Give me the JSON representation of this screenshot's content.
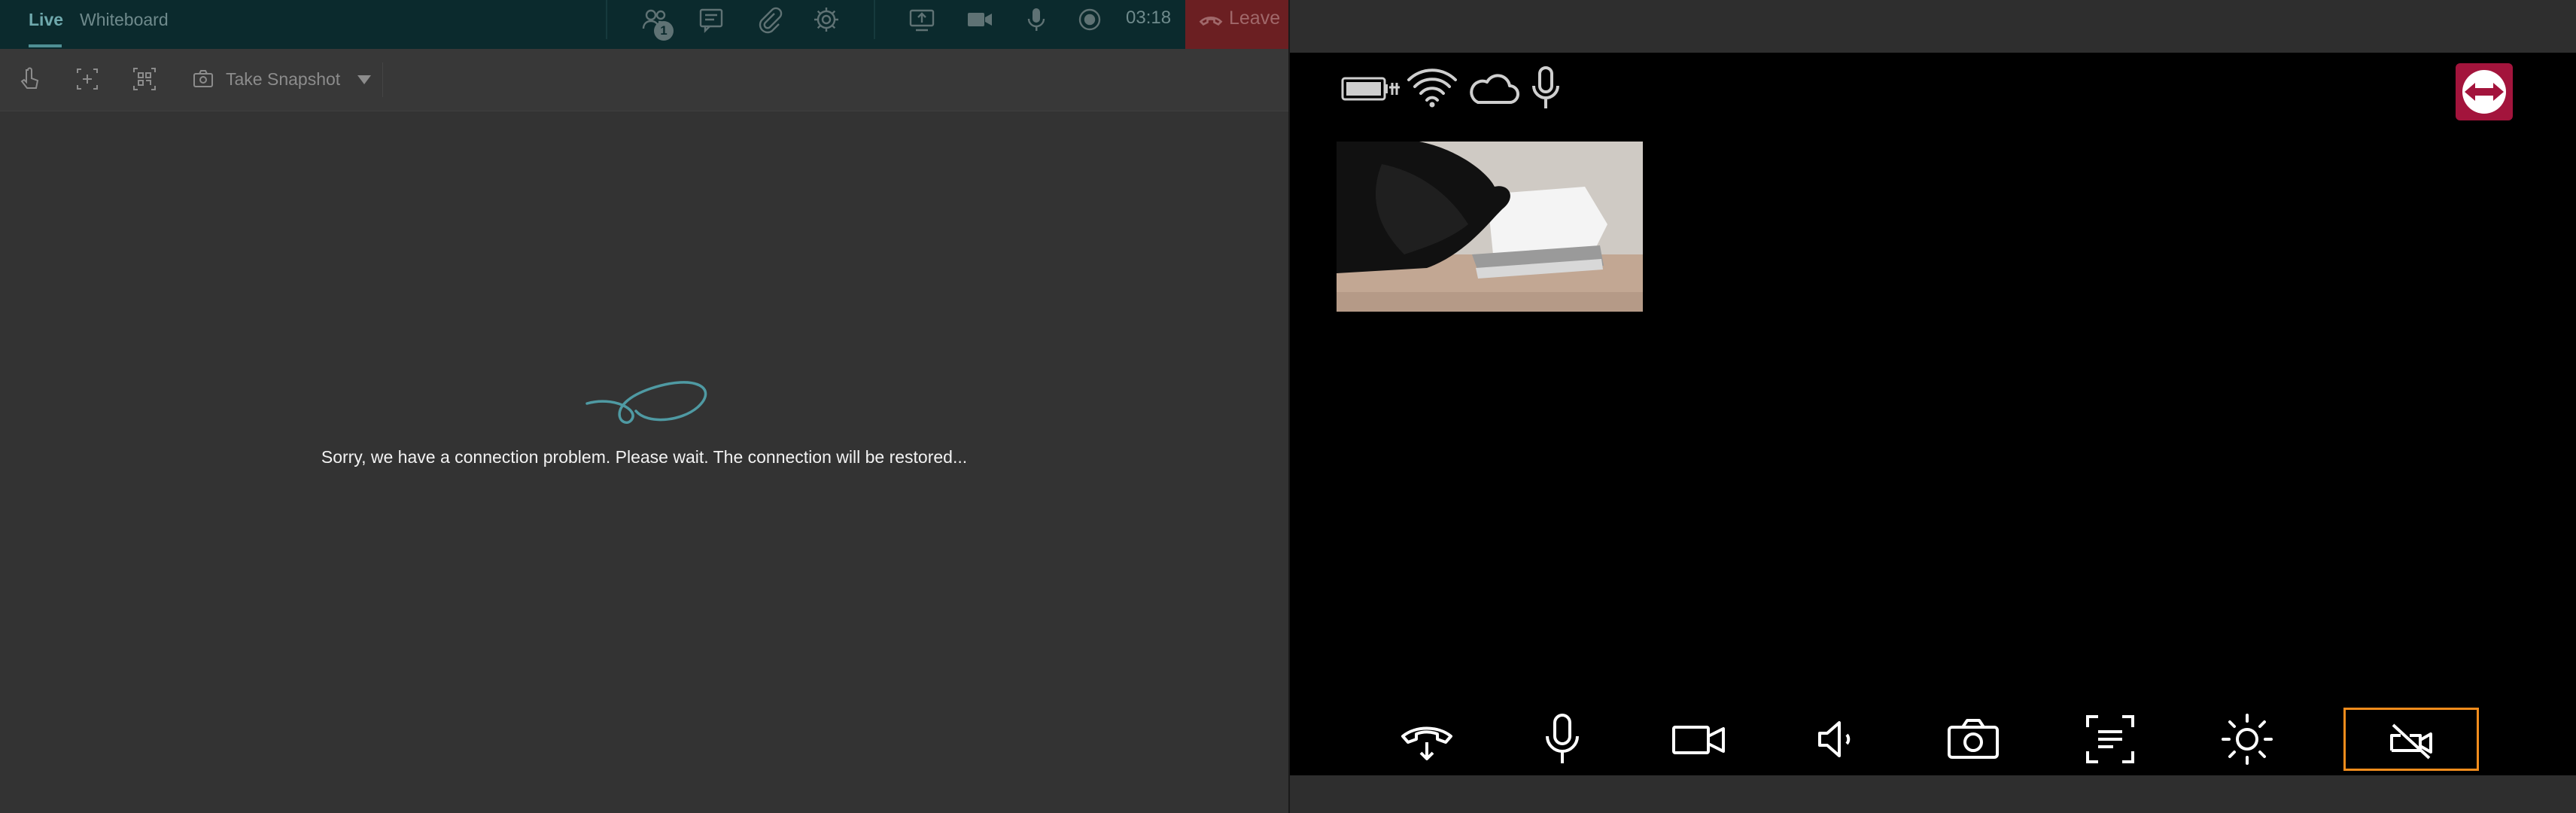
{
  "left": {
    "tabs": [
      {
        "label": "Live",
        "active": true
      },
      {
        "label": "Whiteboard",
        "active": false
      }
    ],
    "toolbar": {
      "participants_count": "1",
      "timer": "03:18",
      "leave_label": "Leave",
      "icons": [
        "participants-icon",
        "chat-icon",
        "attachment-icon",
        "settings-icon",
        "screen-share-icon",
        "camera-icon",
        "microphone-icon",
        "record-icon",
        "hangup-icon"
      ]
    },
    "subtoolbar": {
      "snapshot_label": "Take Snapshot",
      "icons": [
        "pointer-icon",
        "select-area-icon",
        "qr-scan-icon",
        "snapshot-camera-icon",
        "dropdown-arrow-icon"
      ]
    },
    "connection_message": "Sorry, we have a connection problem. Please wait. The connection will be restored..."
  },
  "right": {
    "status_icons": [
      "battery-charging-icon",
      "wifi-icon",
      "cloud-icon",
      "microphone-icon"
    ],
    "controls": [
      "hangup-button",
      "microphone-button",
      "video-button",
      "speaker-button",
      "snapshot-button",
      "scan-document-button",
      "brightness-button",
      "privacy-button"
    ],
    "colors": {
      "logo_bg": "#a3143c",
      "highlight": "#f28c1c",
      "accent": "#4f9aa3",
      "leave_bg": "#6b1f22"
    }
  }
}
